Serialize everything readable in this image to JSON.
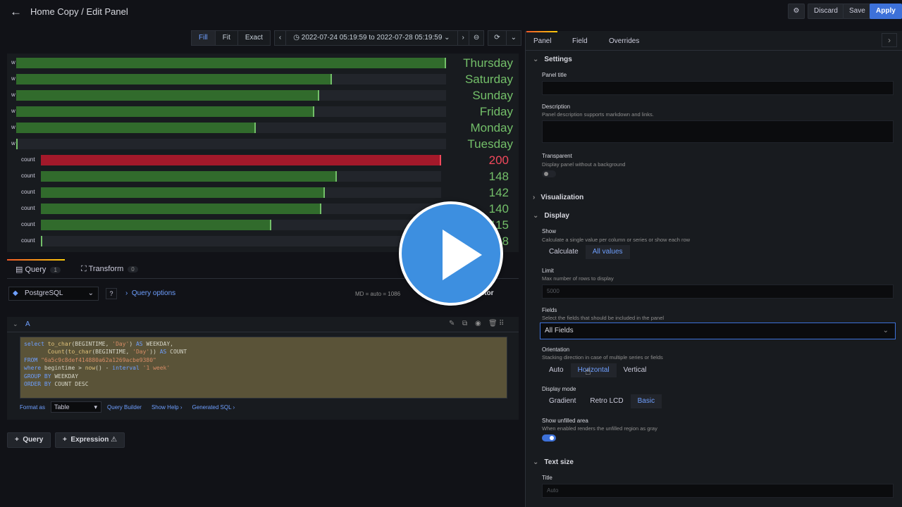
{
  "header": {
    "title": "Home Copy / Edit Panel",
    "discard": "Discard",
    "save": "Save",
    "apply": "Apply"
  },
  "timebar": {
    "fill": "Fill",
    "fit": "Fit",
    "exact": "Exact",
    "range": "2022-07-24 05:19:59 to 2022-07-28 05:19:59"
  },
  "gauges": [
    {
      "label": "w",
      "value": "Thursday",
      "fraction": 1.0,
      "red": false
    },
    {
      "label": "w",
      "value": "Saturday",
      "fraction": 0.735,
      "red": false
    },
    {
      "label": "w",
      "value": "Sunday",
      "fraction": 0.705,
      "red": false
    },
    {
      "label": "w",
      "value": "Friday",
      "fraction": 0.693,
      "red": false
    },
    {
      "label": "w",
      "value": "Monday",
      "fraction": 0.558,
      "red": false
    },
    {
      "label": "w",
      "value": "Tuesday",
      "fraction": 0.002,
      "red": false
    },
    {
      "label": "count",
      "value": "200",
      "fraction": 1.0,
      "red": true
    },
    {
      "label": "count",
      "value": "148",
      "fraction": 0.74,
      "red": false
    },
    {
      "label": "count",
      "value": "142",
      "fraction": 0.71,
      "red": false
    },
    {
      "label": "count",
      "value": "140",
      "fraction": 0.7,
      "red": false
    },
    {
      "label": "count",
      "value": "115",
      "fraction": 0.575,
      "red": false
    },
    {
      "label": "count",
      "value": "8",
      "fraction": 0.004,
      "red": false
    }
  ],
  "query_tabs": {
    "query": "Query",
    "query_count": "1",
    "transform": "Transform",
    "transform_count": "0"
  },
  "datasource": {
    "name": "PostgreSQL",
    "options": "Query options",
    "meta": "MD = auto = 1086",
    "inspector": "pector"
  },
  "editor": {
    "ref": "A",
    "lines": [
      "select to_char(BEGINTIME, 'Day') AS WEEKDAY,",
      "       Count(to_char(BEGINTIME, 'Day')) AS COUNT",
      "FROM \"6a5c9c8def414880a62a1269acbe9380\"",
      "where begintime > now() - interval '1 week'",
      "GROUP BY WEEKDAY",
      "ORDER BY COUNT DESC"
    ],
    "format_as": "Format as",
    "format_value": "Table",
    "query_builder": "Query Builder",
    "show_help": "Show Help ›",
    "generated_sql": "Generated SQL ›"
  },
  "add": {
    "query": "Query",
    "expression": "Expression ⚠"
  },
  "options": {
    "tabs": [
      "Panel",
      "Field",
      "Overrides"
    ],
    "settings": "Settings",
    "panel_title": "Panel title",
    "description": "Description",
    "description_hint": "Panel description supports markdown and links.",
    "transparent": "Transparent",
    "transparent_hint": "Display panel without a background",
    "visualization": "Visualization",
    "display": "Display",
    "show": "Show",
    "show_hint": "Calculate a single value per column or series or show each row",
    "show_options": [
      "Calculate",
      "All values"
    ],
    "limit": "Limit",
    "limit_hint": "Max number of rows to display",
    "limit_placeholder": "5000",
    "fields": "Fields",
    "fields_hint": "Select the fields that should be included in the panel",
    "fields_value": "All Fields",
    "orientation": "Orientation",
    "orientation_hint": "Stacking direction in case of multiple series or fields",
    "orientation_options": [
      "Auto",
      "Horizontal",
      "Vertical"
    ],
    "display_mode": "Display mode",
    "display_mode_options": [
      "Gradient",
      "Retro LCD",
      "Basic"
    ],
    "unfilled": "Show unfilled area",
    "unfilled_hint": "When enabled renders the unfilled region as gray",
    "text_size": "Text size",
    "title_label": "Title",
    "title_placeholder": "Auto"
  }
}
